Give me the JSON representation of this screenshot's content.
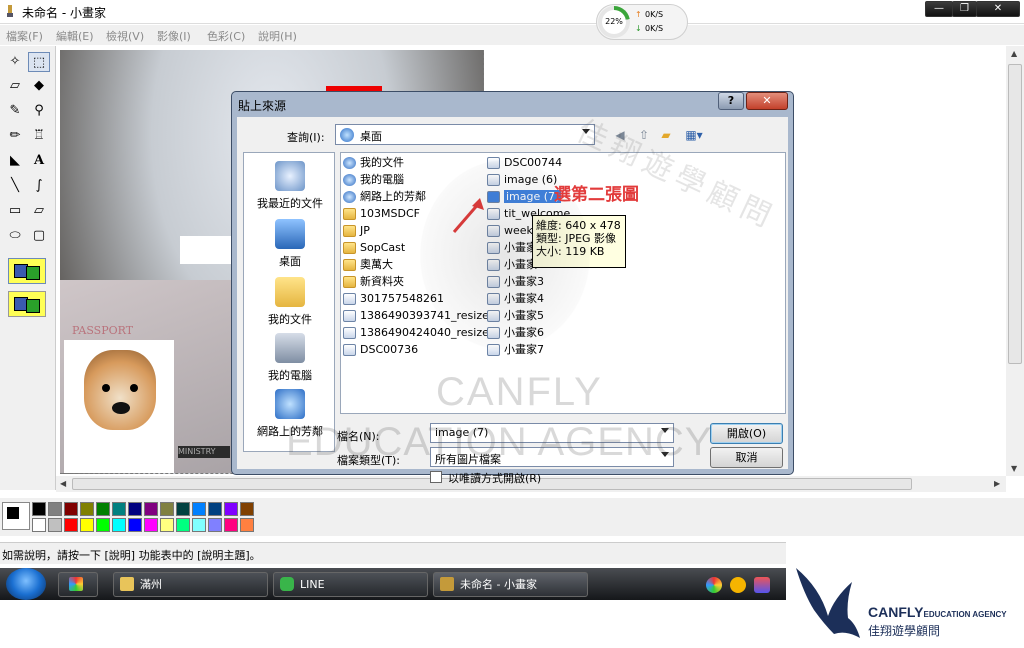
{
  "window": {
    "title": "未命名 - 小畫家",
    "minimize_label": "—",
    "restore_label": "❐",
    "close_label": "✕"
  },
  "netmeter": {
    "percent": "22%",
    "up": "0K/S",
    "down": "0K/S"
  },
  "menu": [
    "檔案(F)",
    "編輯(E)",
    "檢視(V)",
    "影像(I)",
    "色彩(C)",
    "說明(H)"
  ],
  "canvas": {
    "passport_text": "PASSPORT",
    "ministry_text": "MINISTRY"
  },
  "palette": {
    "top": [
      "#000000",
      "#808080",
      "#800000",
      "#808000",
      "#008000",
      "#008080",
      "#000080",
      "#800080",
      "#808040",
      "#004040",
      "#0080ff",
      "#004080",
      "#8000ff",
      "#804000"
    ],
    "bottom": [
      "#ffffff",
      "#c0c0c0",
      "#ff0000",
      "#ffff00",
      "#00ff00",
      "#00ffff",
      "#0000ff",
      "#ff00ff",
      "#ffff80",
      "#00ff80",
      "#80ffff",
      "#8080ff",
      "#ff0080",
      "#ff8040"
    ]
  },
  "status": {
    "help_text": "如需說明，請按一下 [說明] 功能表中的 [說明主題]。"
  },
  "taskbar": {
    "items": [
      "滿州",
      "LINE",
      "未命名 - 小畫家"
    ]
  },
  "logo": {
    "brand": "CANFLY",
    "brand_suffix": "EDUCATION AGENCY",
    "chinese": "佳翔遊學顧問"
  },
  "dialog": {
    "title": "貼上來源",
    "help_label": "?",
    "close_label": "✕",
    "lookin_label": "查詢(I):",
    "lookin_value": "桌面",
    "places": [
      "我最近的文件",
      "桌面",
      "我的文件",
      "我的電腦",
      "網路上的芳鄰"
    ],
    "files_col1": [
      "我的文件",
      "我的電腦",
      "網路上的芳鄰",
      "103MSDCF",
      "JP",
      "SopCast",
      "奧萬大",
      "新資料夾",
      "301757548261",
      "1386490393741_resized",
      "1386490424040_resized",
      "DSC00736"
    ],
    "files_col2": [
      "DSC00744",
      "image (6)",
      "image (7)",
      "tit_welcome",
      "weeker",
      "小畫家",
      "小畫家",
      "小畫家3",
      "小畫家4",
      "小畫家5",
      "小畫家6",
      "小畫家7"
    ],
    "tooltip": [
      "維度: 640 x 478",
      "類型: JPEG 影像",
      "大小: 119 KB"
    ],
    "filename_label": "檔名(N):",
    "filename_value": "image (7)",
    "filetype_label": "檔案類型(T):",
    "filetype_value": "所有圖片檔案",
    "readonly_label": "以唯讀方式開啟(R)",
    "open_label": "開啟(O)",
    "cancel_label": "取消"
  },
  "annotation": "選第二張圖",
  "watermark": {
    "line1": "CANFLY",
    "line2": "EDUCATION AGENCY",
    "cjk": "佳翔遊學顧問"
  }
}
